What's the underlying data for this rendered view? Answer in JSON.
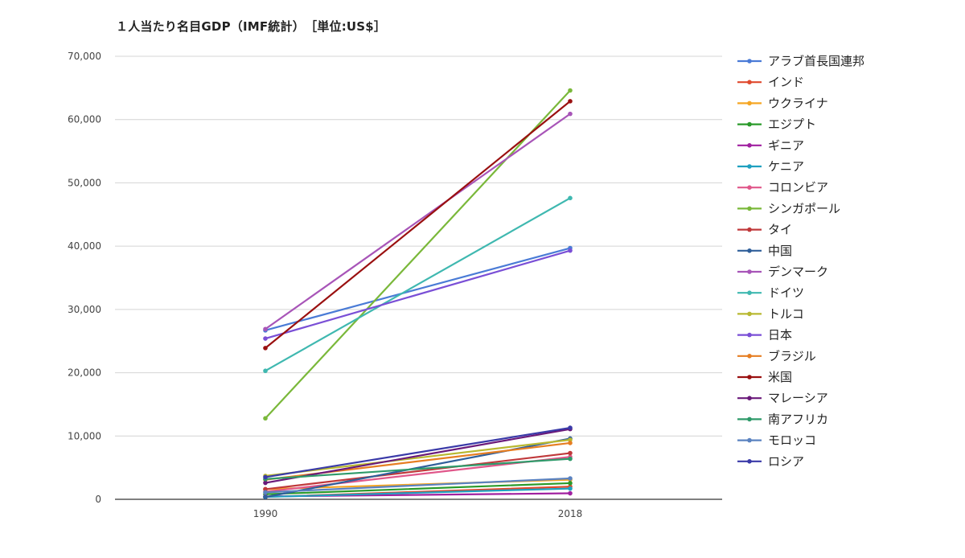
{
  "chart_data": {
    "type": "line",
    "title": "１人当たり名目GDP（IMF統計）　［単位:US$］",
    "categories": [
      "1990",
      "2018"
    ],
    "ylim": [
      0,
      70000
    ],
    "yticks": [
      0,
      10000,
      20000,
      30000,
      40000,
      50000,
      60000,
      70000
    ],
    "ytick_labels": [
      "0",
      "10,000",
      "20,000",
      "30,000",
      "40,000",
      "50,000",
      "60,000",
      "70,000"
    ],
    "grid": true,
    "legend_position": "right",
    "series": [
      {
        "name": "アラブ首長国連邦",
        "color": "#4a7bd6",
        "values": [
          26700,
          39700
        ]
      },
      {
        "name": "インド",
        "color": "#e04a2e",
        "values": [
          370,
          2000
        ]
      },
      {
        "name": "ウクライナ",
        "color": "#f5a623",
        "values": [
          1600,
          3100
        ]
      },
      {
        "name": "エジプト",
        "color": "#2a9a2a",
        "values": [
          800,
          2550
        ]
      },
      {
        "name": "ギニア",
        "color": "#a020a0",
        "values": [
          450,
          950
        ]
      },
      {
        "name": "ケニア",
        "color": "#1fa0c0",
        "values": [
          370,
          1700
        ]
      },
      {
        "name": "コロンビア",
        "color": "#e0578a",
        "values": [
          1200,
          6700
        ]
      },
      {
        "name": "シンガポール",
        "color": "#7ab83a",
        "values": [
          12800,
          64600
        ]
      },
      {
        "name": "タイ",
        "color": "#c0393b",
        "values": [
          1600,
          7300
        ]
      },
      {
        "name": "中国",
        "color": "#2f5f9a",
        "values": [
          350,
          9600
        ]
      },
      {
        "name": "デンマーク",
        "color": "#a855b8",
        "values": [
          26900,
          60900
        ]
      },
      {
        "name": "ドイツ",
        "color": "#3fb8b0",
        "values": [
          20300,
          47600
        ]
      },
      {
        "name": "トルコ",
        "color": "#b8b830",
        "values": [
          3700,
          9400
        ]
      },
      {
        "name": "日本",
        "color": "#7a4fd6",
        "values": [
          25400,
          39300
        ]
      },
      {
        "name": "ブラジル",
        "color": "#e67e22",
        "values": [
          3100,
          8900
        ]
      },
      {
        "name": "米国",
        "color": "#9a1010",
        "values": [
          23900,
          62900
        ]
      },
      {
        "name": "マレーシア",
        "color": "#6a1a7a",
        "values": [
          2600,
          11100
        ]
      },
      {
        "name": "南アフリカ",
        "color": "#2e9a6a",
        "values": [
          3200,
          6400
        ]
      },
      {
        "name": "モロッコ",
        "color": "#5a82c0",
        "values": [
          1100,
          3300
        ]
      },
      {
        "name": "ロシア",
        "color": "#3a3aa8",
        "values": [
          3500,
          11300
        ]
      }
    ]
  }
}
